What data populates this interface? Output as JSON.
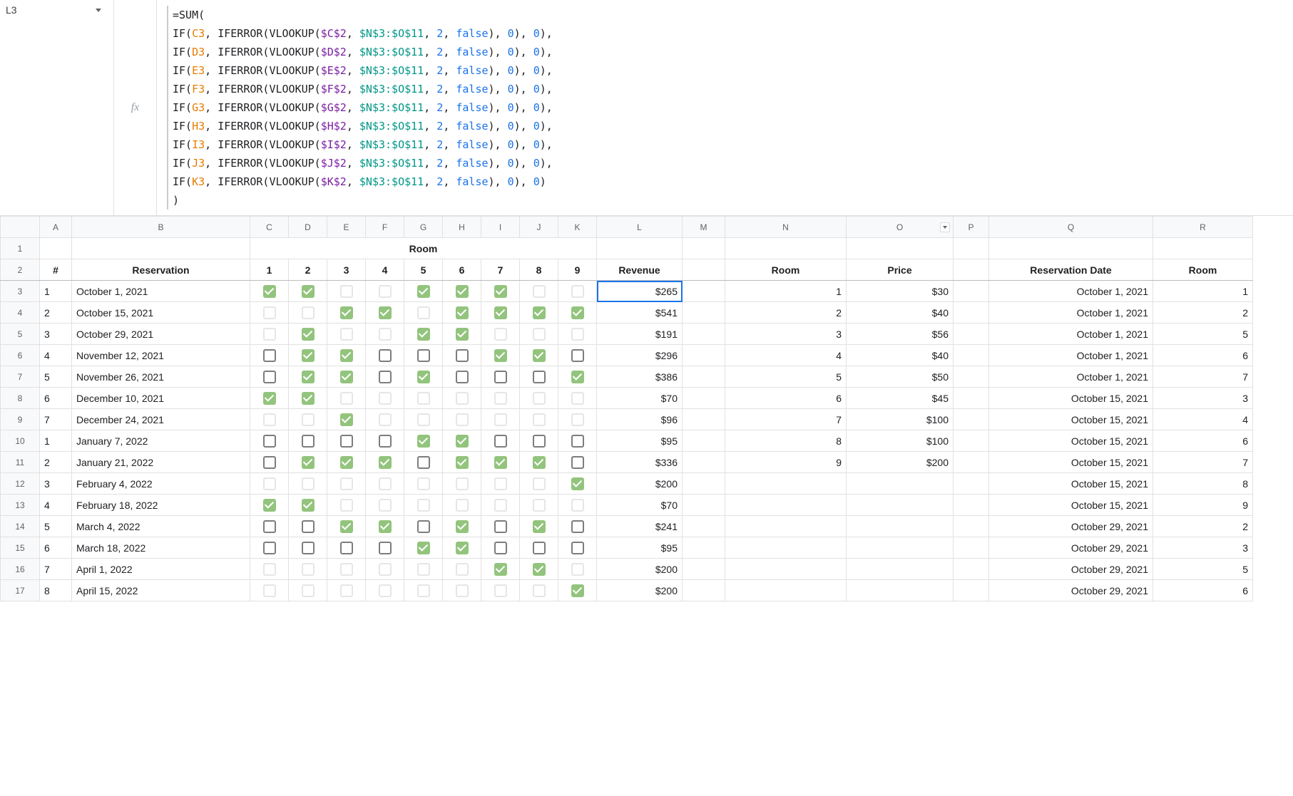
{
  "nameBox": "L3",
  "formula": {
    "head": "=SUM(",
    "lines": [
      {
        "ref": "C3",
        "abs": "$C$2"
      },
      {
        "ref": "D3",
        "abs": "$D$2"
      },
      {
        "ref": "E3",
        "abs": "$E$2"
      },
      {
        "ref": "F3",
        "abs": "$F$2"
      },
      {
        "ref": "G3",
        "abs": "$G$2"
      },
      {
        "ref": "H3",
        "abs": "$H$2"
      },
      {
        "ref": "I3",
        "abs": "$I$2"
      },
      {
        "ref": "J3",
        "abs": "$J$2"
      },
      {
        "ref": "K3",
        "abs": "$K$2"
      }
    ],
    "range": "$N$3:$O$11",
    "col": "2",
    "bool": "false",
    "zero": "0",
    "tail": ")"
  },
  "columns": [
    "A",
    "B",
    "C",
    "D",
    "E",
    "F",
    "G",
    "H",
    "I",
    "J",
    "K",
    "L",
    "M",
    "N",
    "O",
    "P",
    "Q",
    "R"
  ],
  "colDropdown": "O",
  "row1": {
    "roomMergeLabel": "Room"
  },
  "row2": {
    "A": "#",
    "B": "Reservation",
    "C": "1",
    "D": "2",
    "E": "3",
    "F": "4",
    "G": "5",
    "H": "6",
    "I": "7",
    "J": "8",
    "K": "9",
    "L": "Revenue",
    "N": "Room",
    "O": "Price",
    "Q": "Reservation Date",
    "R": "Room"
  },
  "darkRows": [
    6,
    7,
    10,
    11,
    14,
    15
  ],
  "rows": [
    {
      "r": 3,
      "A": "1",
      "B": "October 1, 2021",
      "cb": [
        1,
        1,
        0,
        0,
        1,
        1,
        1,
        0,
        0
      ],
      "L": "$265",
      "N": "1",
      "O": "$30",
      "Q": "October 1, 2021",
      "R": "1"
    },
    {
      "r": 4,
      "A": "2",
      "B": "October 15, 2021",
      "cb": [
        0,
        0,
        1,
        1,
        0,
        1,
        1,
        1,
        1
      ],
      "L": "$541",
      "N": "2",
      "O": "$40",
      "Q": "October 1, 2021",
      "R": "2"
    },
    {
      "r": 5,
      "A": "3",
      "B": "October 29, 2021",
      "cb": [
        0,
        1,
        0,
        0,
        1,
        1,
        0,
        0,
        0
      ],
      "L": "$191",
      "N": "3",
      "O": "$56",
      "Q": "October 1, 2021",
      "R": "5"
    },
    {
      "r": 6,
      "A": "4",
      "B": "November 12, 2021",
      "cb": [
        0,
        1,
        1,
        0,
        0,
        0,
        1,
        1,
        0
      ],
      "L": "$296",
      "N": "4",
      "O": "$40",
      "Q": "October 1, 2021",
      "R": "6"
    },
    {
      "r": 7,
      "A": "5",
      "B": "November 26, 2021",
      "cb": [
        0,
        1,
        1,
        0,
        1,
        0,
        0,
        0,
        1
      ],
      "L": "$386",
      "N": "5",
      "O": "$50",
      "Q": "October 1, 2021",
      "R": "7"
    },
    {
      "r": 8,
      "A": "6",
      "B": "December 10, 2021",
      "cb": [
        1,
        1,
        0,
        0,
        0,
        0,
        0,
        0,
        0
      ],
      "L": "$70",
      "N": "6",
      "O": "$45",
      "Q": "October 15, 2021",
      "R": "3"
    },
    {
      "r": 9,
      "A": "7",
      "B": "December 24, 2021",
      "cb": [
        0,
        0,
        1,
        0,
        0,
        0,
        0,
        0,
        0
      ],
      "L": "$96",
      "N": "7",
      "O": "$100",
      "Q": "October 15, 2021",
      "R": "4"
    },
    {
      "r": 10,
      "A": "1",
      "B": "January 7, 2022",
      "cb": [
        0,
        0,
        0,
        0,
        1,
        1,
        0,
        0,
        0
      ],
      "L": "$95",
      "N": "8",
      "O": "$100",
      "Q": "October 15, 2021",
      "R": "6"
    },
    {
      "r": 11,
      "A": "2",
      "B": "January 21, 2022",
      "cb": [
        0,
        1,
        1,
        1,
        0,
        1,
        1,
        1,
        0
      ],
      "L": "$336",
      "N": "9",
      "O": "$200",
      "Q": "October 15, 2021",
      "R": "7"
    },
    {
      "r": 12,
      "A": "3",
      "B": "February 4, 2022",
      "cb": [
        0,
        0,
        0,
        0,
        0,
        0,
        0,
        0,
        1
      ],
      "L": "$200",
      "N": "",
      "O": "",
      "Q": "October 15, 2021",
      "R": "8"
    },
    {
      "r": 13,
      "A": "4",
      "B": "February 18, 2022",
      "cb": [
        1,
        1,
        0,
        0,
        0,
        0,
        0,
        0,
        0
      ],
      "L": "$70",
      "N": "",
      "O": "",
      "Q": "October 15, 2021",
      "R": "9"
    },
    {
      "r": 14,
      "A": "5",
      "B": "March 4, 2022",
      "cb": [
        0,
        0,
        1,
        1,
        0,
        1,
        0,
        1,
        0
      ],
      "L": "$241",
      "N": "",
      "O": "",
      "Q": "October 29, 2021",
      "R": "2"
    },
    {
      "r": 15,
      "A": "6",
      "B": "March 18, 2022",
      "cb": [
        0,
        0,
        0,
        0,
        1,
        1,
        0,
        0,
        0
      ],
      "L": "$95",
      "N": "",
      "O": "",
      "Q": "October 29, 2021",
      "R": "3"
    },
    {
      "r": 16,
      "A": "7",
      "B": "April 1, 2022",
      "cb": [
        0,
        0,
        0,
        0,
        0,
        0,
        1,
        1,
        0
      ],
      "L": "$200",
      "N": "",
      "O": "",
      "Q": "October 29, 2021",
      "R": "5"
    },
    {
      "r": 17,
      "A": "8",
      "B": "April 15, 2022",
      "cb": [
        0,
        0,
        0,
        0,
        0,
        0,
        0,
        0,
        1
      ],
      "L": "$200",
      "N": "",
      "O": "",
      "Q": "October 29, 2021",
      "R": "6"
    }
  ],
  "selectedCell": {
    "row": 3,
    "col": "L"
  }
}
